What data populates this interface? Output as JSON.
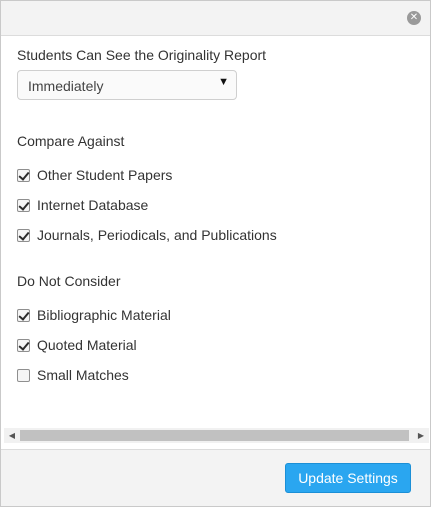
{
  "dialog": {
    "close_glyph": "✕"
  },
  "report_visibility": {
    "label": "Students Can See the Originality Report",
    "selected": "Immediately",
    "caret": "▼"
  },
  "compare_against": {
    "heading": "Compare Against",
    "options": [
      {
        "label": "Other Student Papers",
        "checked": true
      },
      {
        "label": "Internet Database",
        "checked": true
      },
      {
        "label": "Journals, Periodicals, and Publications",
        "checked": true
      }
    ]
  },
  "do_not_consider": {
    "heading": "Do Not Consider",
    "options": [
      {
        "label": "Bibliographic Material",
        "checked": true
      },
      {
        "label": "Quoted Material",
        "checked": true
      },
      {
        "label": "Small Matches",
        "checked": false
      }
    ]
  },
  "scrollbar": {
    "left_arrow": "◀",
    "right_arrow": "▶"
  },
  "footer": {
    "update_label": "Update Settings"
  },
  "colors": {
    "accent": "#2aa6f0",
    "titlebar": "#f3f3f3"
  }
}
